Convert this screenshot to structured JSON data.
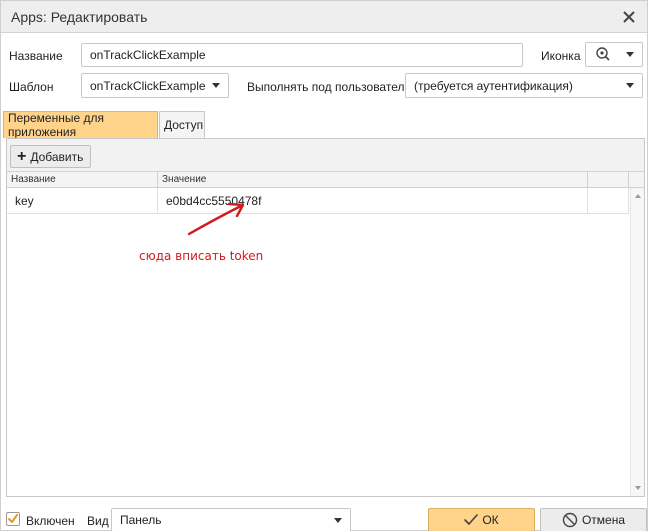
{
  "window": {
    "title": "Apps: Редактировать"
  },
  "form": {
    "name_label": "Название",
    "name_value": "onTrackClickExample",
    "icon_label": "Иконка",
    "template_label": "Шаблон",
    "template_value": "onTrackClickExample",
    "run_as_label": "Выполнять под пользователем",
    "run_as_value": "(требуется аутентификация)"
  },
  "tabs": [
    {
      "label": "Переменные для приложения",
      "active": true
    },
    {
      "label": "Доступ",
      "active": false
    }
  ],
  "toolbar": {
    "add_label": "Добавить"
  },
  "grid": {
    "columns": [
      "Название",
      "Значение"
    ],
    "rows": [
      {
        "name": "key",
        "value": "e0bd4cc5550478f"
      }
    ]
  },
  "annotation": {
    "text": "сюда вписать token",
    "color": "#d11a1a"
  },
  "footer": {
    "enabled_label": "Включен",
    "enabled_checked": true,
    "view_label": "Вид",
    "view_value": "Панель",
    "ok_label": "ОК",
    "cancel_label": "Отмена"
  },
  "colors": {
    "accent": "#ffd38a",
    "checkmark": "#e39a1b"
  },
  "icons": [
    "close-icon",
    "map-pin-search-icon",
    "chevron-down-icon",
    "plus-icon",
    "check-icon",
    "cancel-circle-icon"
  ]
}
